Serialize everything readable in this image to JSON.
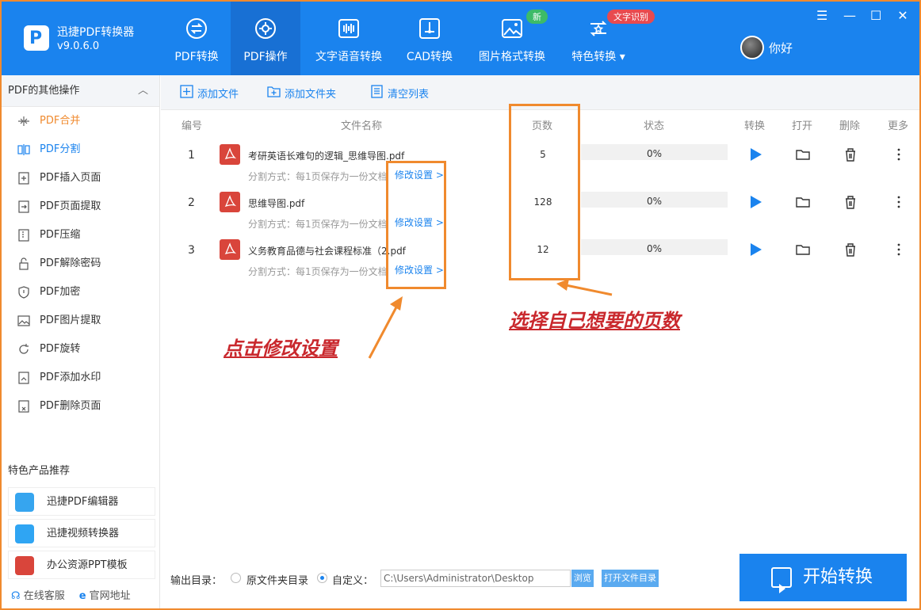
{
  "app": {
    "name": "迅捷PDF转换器",
    "version": "v9.0.6.0",
    "user": "你好"
  },
  "nav": [
    {
      "label": "PDF转换",
      "icon": "convert-icon"
    },
    {
      "label": "PDF操作",
      "icon": "gear-icon",
      "active": true
    },
    {
      "label": "文字语音转换",
      "icon": "audio-wave-icon"
    },
    {
      "label": "CAD转换",
      "icon": "cad-icon"
    },
    {
      "label": "图片格式转换",
      "icon": "image-icon",
      "badge": "新"
    },
    {
      "label": "特色转换",
      "icon": "star-convert-icon",
      "badge": "文字识别"
    }
  ],
  "sidebar": {
    "title": "PDF的其他操作",
    "items": [
      "PDF合并",
      "PDF分割",
      "PDF插入页面",
      "PDF页面提取",
      "PDF压缩",
      "PDF解除密码",
      "PDF加密",
      "PDF图片提取",
      "PDF旋转",
      "PDF添加水印",
      "PDF删除页面"
    ],
    "feature_title": "特色产品推荐",
    "products": [
      "迅捷PDF编辑器",
      "迅捷视频转换器",
      "办公资源PPT模板"
    ],
    "footer": [
      "在线客服",
      "官网地址"
    ]
  },
  "toolbar": {
    "add_file": "添加文件",
    "add_folder": "添加文件夹",
    "clear_list": "清空列表"
  },
  "table": {
    "headers": [
      "编号",
      "文件名称",
      "页数",
      "状态",
      "转换",
      "打开",
      "删除",
      "更多"
    ],
    "rows": [
      {
        "num": "1",
        "name": "考研英语长难句的逻辑_思维导图.pdf",
        "split": "分割方式：每1页保存为一份文档",
        "modify": "修改设置 >",
        "pages": "5",
        "status": "0%"
      },
      {
        "num": "2",
        "name": "思维导图.pdf",
        "split": "分割方式：每1页保存为一份文档",
        "modify": "修改设置 >",
        "pages": "128",
        "status": "0%"
      },
      {
        "num": "3",
        "name": "义务教育品德与社会课程标准（2.pdf",
        "split": "分割方式：每1页保存为一份文档",
        "modify": "修改设置 >",
        "pages": "12",
        "status": "0%"
      }
    ]
  },
  "annotations": {
    "click_modify": "点击修改设置",
    "choose_pages": "选择自己想要的页数"
  },
  "output": {
    "label": "输出目录：",
    "option_original": "原文件夹目录",
    "option_custom": "自定义：",
    "path": "C:\\Users\\Administrator\\Desktop",
    "browse": "浏览",
    "open_dir": "打开文件目录"
  },
  "start_button": "开始转换",
  "colors": {
    "primary": "#1a83ee",
    "accent": "#f08a2e",
    "annotation": "#c9282d"
  }
}
